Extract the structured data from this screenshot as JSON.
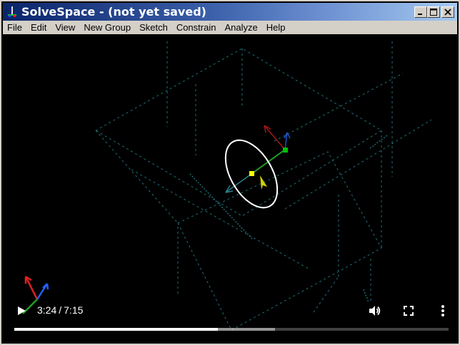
{
  "window": {
    "title": "SolveSpace - (not yet saved)"
  },
  "menu": {
    "items": [
      "File",
      "Edit",
      "View",
      "New Group",
      "Sketch",
      "Constrain",
      "Analyze",
      "Help"
    ]
  },
  "player": {
    "current_time": "3:24",
    "separator": "/",
    "duration": "7:15",
    "played_fraction": 0.469,
    "buffered_fraction": 0.6
  },
  "icons": {
    "app": "solvespace-icon",
    "minimize": "minimize-icon",
    "maximize": "maximize-icon",
    "close": "close-icon",
    "play": "play-icon",
    "volume": "volume-icon",
    "fullscreen": "fullscreen-icon",
    "more": "more-vert-icon"
  },
  "colors": {
    "grid_line": "#1f6f7a",
    "ellipse": "#ffffff",
    "point_center": "#ffff00",
    "point_handle": "#00c000",
    "axis_x": "#e02020",
    "axis_y": "#2060ff",
    "axis_z": "#20a020"
  }
}
